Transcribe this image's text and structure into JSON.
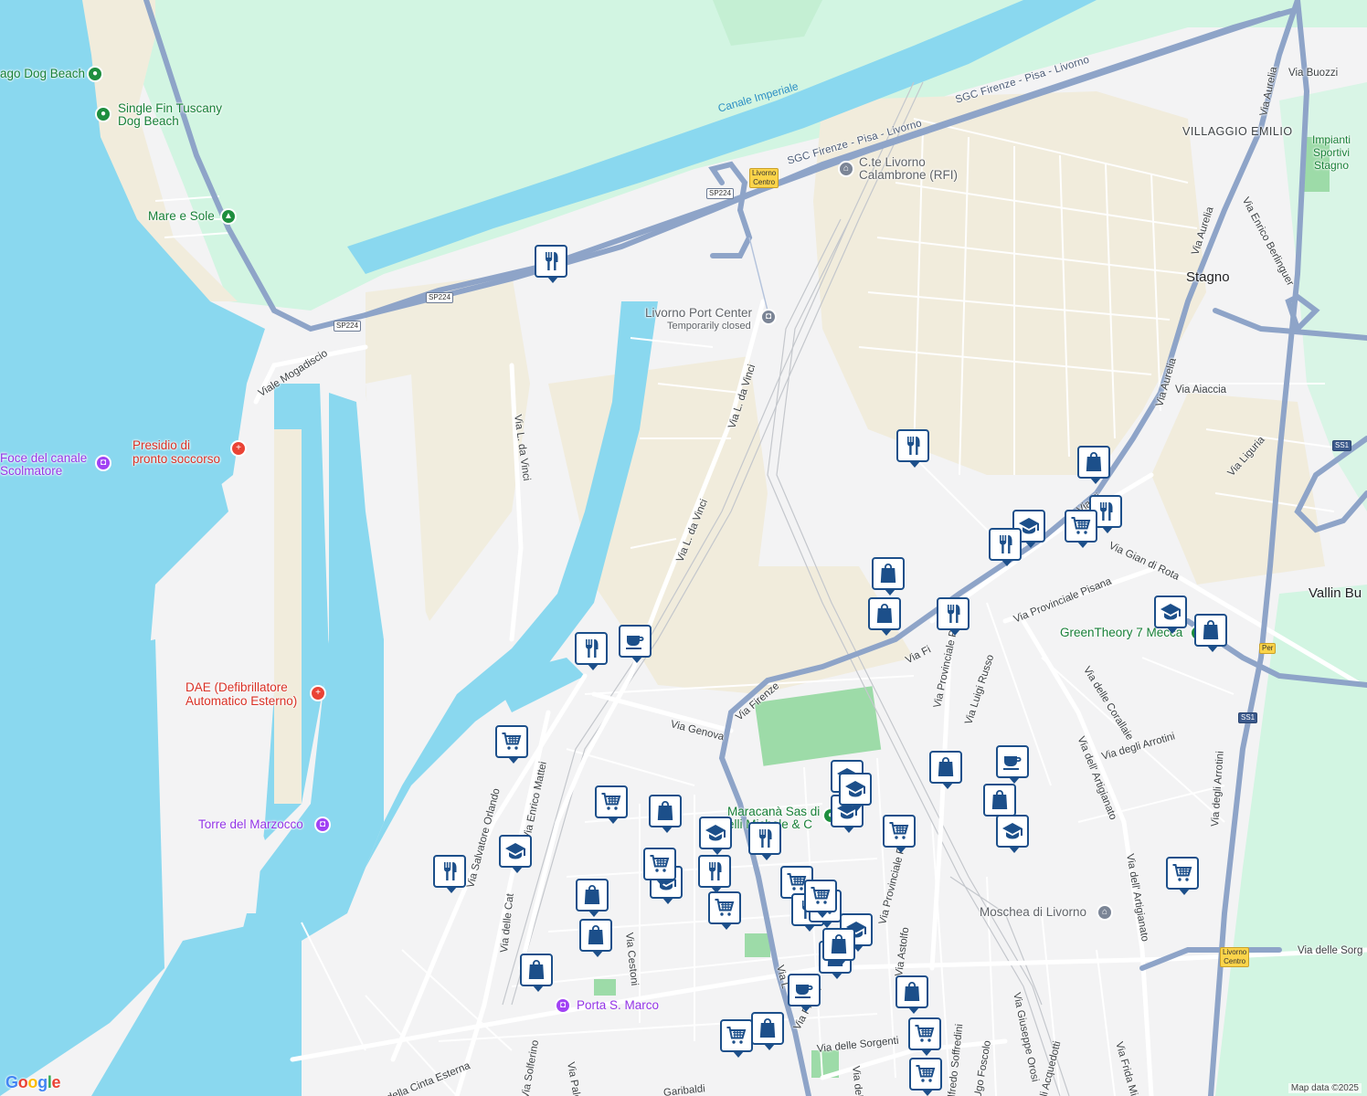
{
  "map": {
    "colors": {
      "sea": "#8ad8ef",
      "land": "#f3f3f4",
      "park": "#d2f5e2",
      "green": "#9ddba8",
      "sand": "#f1ecdc",
      "highway": "#8ea4c8",
      "pin": "#1c4f8a"
    },
    "places": {
      "villaggio_emilio": "VILLAGGIO\nEMILIO",
      "stagno": "Stagno",
      "vallin": "Vallin Bu",
      "impianti": "Impianti\nSportivi\nStagno"
    },
    "water": {
      "canale": "Canale Imperiale"
    },
    "pois": {
      "dog_beach_partial": "ago Dog Beach",
      "single_fin": "Single Fin Tuscany\nDog Beach",
      "mare_sole": "Mare e Sole",
      "presidio": "Presidio di\npronto soccorso",
      "foce": "Foce del canale\nScolmatore",
      "dae": "DAE (Defibrillatore\nAutomatico Esterno)",
      "torre": "Torre del Marzocco",
      "cte": "C.te Livorno\nCalambrone (RFI)",
      "port_center": "Livorno Port Center",
      "port_center_status": "Temporarily closed",
      "greentheory": "GreenTheory 7 Mecca",
      "maracana": "Maracanà Sas di\nelli Michele & C",
      "moschea": "Moschea di Livorno",
      "porta": "Porta S. Marco"
    },
    "roads": {
      "sgc1": "SGC Firenze - Pisa - Livorno",
      "sgc2": "SGC Firenze - Pisa - Livorno",
      "mogadiscio": "Viale Mogadiscio",
      "ldavinci1": "Via L. da Vinci",
      "ldavinci2": "Via L. da Vinci",
      "ldavinci3": "Via L. da Vinci",
      "aurelia1": "Via Aurelia",
      "aurelia2": "Via Aurelia",
      "aurelia3": "Via Aurelia",
      "buozzi": "Via Buozzi",
      "berlinguer": "Via Enrico Berlinguer",
      "aiaccia": "Via Aiaccia",
      "liguria": "Via Liguria",
      "firenze1": "Via Firenze",
      "firenze2": "Via Fi",
      "firenze3": "Via Fi",
      "rota": "Via Gian di Rota",
      "pisana1": "Via Provinciale Pisana",
      "pisana2": "Via Provinciale Pisana",
      "pisana3": "Via Provinciale P",
      "russo": "Via Luigi Russo",
      "corallaie": "Via delle Corallaie",
      "arrotini1": "Via degli Arrotini",
      "arrotini2": "Via degli Arrotini",
      "artigianato1": "Via dell' Artigianato",
      "artigianato2": "Via dell' Artigianato",
      "genova": "Via Genova",
      "orlando": "Via Salvatore Orlando",
      "mattei": "Via Enrico Mattei",
      "cat": "Via delle Cat",
      "cestoni": "Via Cestoni",
      "cinta": "della Cinta Esterna",
      "solferino": "Via Solferino",
      "pale": "Via Pale",
      "garibaldi": "Garibaldi",
      "sorgenti": "Via delle Sorgenti",
      "astolfo": "Via Astolfo",
      "soffredini": "lfredo Soffredini",
      "foscolo": "Ugo Foscolo",
      "orosi": "Via Giuseppe Orosi",
      "acquedotti": "lli Acquedotti",
      "frida": "Via Frida Misu",
      "sorg2": "Via delle Sorg",
      "ldv_s": "Via L",
      "prov_s": "Via Provin",
      "del_s": "Via del"
    },
    "shields": {
      "sp224a": "SP224",
      "sp224b": "SP224",
      "sp224c": "SP224",
      "livorno_centro1": "Livorno\nCentro",
      "livorno_centro2": "Livorno\nCentro",
      "ss1a": "SS1",
      "ss1b": "SS1",
      "per": "Per"
    },
    "attribution": "Map data ©2025",
    "logo": "Google",
    "pins": [
      {
        "type": "restaurant"
      },
      {
        "type": "restaurant"
      },
      {
        "type": "cafe"
      },
      {
        "type": "shopping"
      },
      {
        "type": "restaurant"
      },
      {
        "type": "shopping"
      },
      {
        "type": "school"
      },
      {
        "type": "restaurant"
      },
      {
        "type": "grocery"
      },
      {
        "type": "restaurant"
      },
      {
        "type": "shopping"
      },
      {
        "type": "shopping"
      },
      {
        "type": "restaurant"
      },
      {
        "type": "school"
      },
      {
        "type": "shopping"
      },
      {
        "type": "grocery"
      },
      {
        "type": "shopping"
      },
      {
        "type": "cafe"
      },
      {
        "type": "shopping"
      },
      {
        "type": "school"
      },
      {
        "type": "grocery"
      },
      {
        "type": "grocery"
      },
      {
        "type": "restaurant"
      },
      {
        "type": "school"
      },
      {
        "type": "shopping"
      },
      {
        "type": "school"
      },
      {
        "type": "grocery"
      },
      {
        "type": "restaurant"
      },
      {
        "type": "school"
      },
      {
        "type": "school"
      },
      {
        "type": "grocery"
      },
      {
        "type": "school"
      },
      {
        "type": "school"
      },
      {
        "type": "grocery"
      },
      {
        "type": "restaurant"
      },
      {
        "type": "grocery"
      },
      {
        "type": "restaurant"
      },
      {
        "type": "shopping"
      },
      {
        "type": "shopping"
      },
      {
        "type": "grocery"
      },
      {
        "type": "shopping"
      },
      {
        "type": "school"
      },
      {
        "type": "shopping"
      },
      {
        "type": "cafe"
      },
      {
        "type": "shopping"
      },
      {
        "type": "grocery"
      },
      {
        "type": "shopping"
      },
      {
        "type": "grocery"
      },
      {
        "type": "grocery"
      },
      {
        "type": "grocery"
      }
    ]
  }
}
